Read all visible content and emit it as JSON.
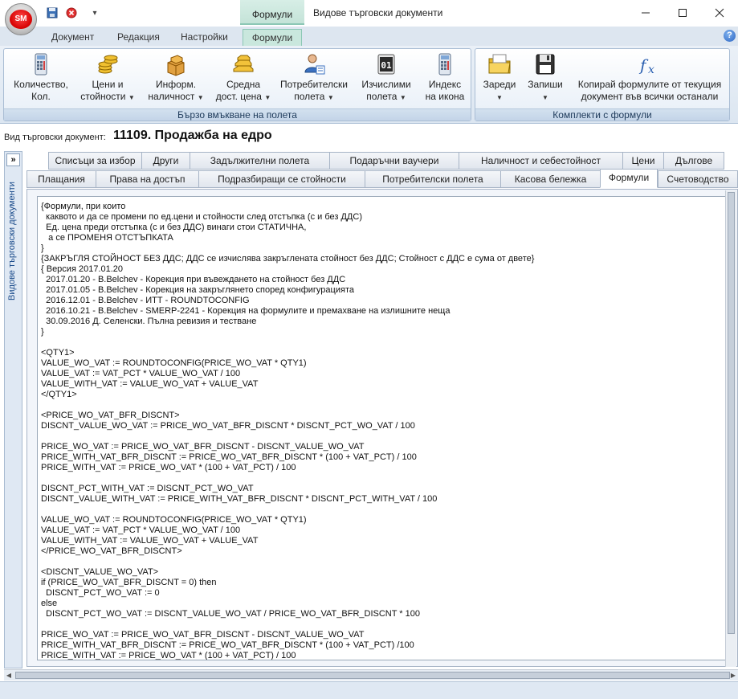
{
  "app": {
    "orb_label": "SM",
    "context_tab_title": "Формули",
    "window_title": "Видове търговски документи"
  },
  "ribbon_tabs": [
    "Документ",
    "Редакция",
    "Настройки",
    "Формули"
  ],
  "ribbon_groups": [
    {
      "label": "Бързо вмъкване на полета",
      "buttons": [
        {
          "line1": "Количество,",
          "line2": "Кол.",
          "has_dropdown": false,
          "icon": "calculator-icon"
        },
        {
          "line1": "Цени и",
          "line2": "стойности",
          "has_dropdown": true,
          "icon": "coins-icon"
        },
        {
          "line1": "Информ.",
          "line2": "наличност",
          "has_dropdown": true,
          "icon": "boxes-icon"
        },
        {
          "line1": "Средна",
          "line2": "дост. цена",
          "has_dropdown": true,
          "icon": "gold-bars-icon"
        },
        {
          "line1": "Потребителски",
          "line2": "полета",
          "has_dropdown": true,
          "icon": "user-fields-icon"
        },
        {
          "line1": "Изчислими",
          "line2": "полета",
          "has_dropdown": true,
          "icon": "counter-icon"
        },
        {
          "line1": "Индекс",
          "line2": "на икона",
          "has_dropdown": false,
          "icon": "calculator-icon"
        }
      ]
    },
    {
      "label": "Комплекти с формули",
      "buttons": [
        {
          "line1": "Зареди",
          "line2": "",
          "has_dropdown": true,
          "icon": "folder-icon"
        },
        {
          "line1": "Запиши",
          "line2": "",
          "has_dropdown": true,
          "icon": "floppy-disk-icon"
        },
        {
          "line1": "Копирай формулите от текущия",
          "line2": "документ във всички останали",
          "has_dropdown": false,
          "icon": "fx-icon"
        }
      ]
    }
  ],
  "document": {
    "type_label": "Вид търговски документ:",
    "title": "11109. Продажба на едро"
  },
  "side_panel": {
    "toggle_label": "»",
    "label": "Видове търговски документи"
  },
  "tabs_row1": [
    "Списъци за избор",
    "Други",
    "Задължителни полета",
    "Подаръчни ваучери",
    "Наличност и себестойност",
    "Цени",
    "Дългове"
  ],
  "tabs_row2": [
    "Плащания",
    "Права на достъп",
    "Подразбиращи се стойности",
    "Потребителски полета",
    "Касова бележка",
    "Формули",
    "Счетоводство"
  ],
  "active_tab": "Формули",
  "formula_lines": [
    "{Формули, при които",
    "  каквото и да се промени по ед.цени и стойности след отстъпка (с и без ДДС)",
    "  Ед. цена преди отстъпка (с и без ДДС) винаги стои СТАТИЧНА,",
    "   а се ПРОМЕНЯ ОТСТЪПКАТА",
    "}",
    "{ЗАКРЪГЛЯ СТОЙНОСТ БЕЗ ДДС; ДДС се изчислява закръглената стойност без ДДС; Стойност с ДДС е сума от двете}",
    "{ Версия 2017.01.20",
    "  2017.01.20 - B.Belchev - Корекция при въвеждането на стойност без ДДС",
    "  2017.01.05 - B.Belchev - Корекция на закръглянето според конфигурацията",
    "  2016.12.01 - B.Belchev - ИТТ - ROUNDTOCONFIG",
    "  2016.10.21 - B.Belchev - SMERP-2241 - Корекция на формулите и премахване на излишните неща",
    "  30.09.2016 Д. Селенски. Пълна ревизия и тестване",
    "}",
    "",
    "<QTY1>",
    "VALUE_WO_VAT := ROUNDTOCONFIG(PRICE_WO_VAT * QTY1)",
    "VALUE_VAT := VAT_PCT * VALUE_WO_VAT / 100",
    "VALUE_WITH_VAT := VALUE_WO_VAT + VALUE_VAT",
    "</QTY1>",
    "",
    "<PRICE_WO_VAT_BFR_DISCNT>",
    "DISCNT_VALUE_WO_VAT := PRICE_WO_VAT_BFR_DISCNT * DISCNT_PCT_WO_VAT / 100",
    "",
    "PRICE_WO_VAT := PRICE_WO_VAT_BFR_DISCNT - DISCNT_VALUE_WO_VAT",
    "PRICE_WITH_VAT_BFR_DISCNT := PRICE_WO_VAT_BFR_DISCNT * (100 + VAT_PCT) / 100",
    "PRICE_WITH_VAT := PRICE_WO_VAT * (100 + VAT_PCT) / 100",
    "",
    "DISCNT_PCT_WITH_VAT := DISCNT_PCT_WO_VAT",
    "DISCNT_VALUE_WITH_VAT := PRICE_WITH_VAT_BFR_DISCNT * DISCNT_PCT_WITH_VAT / 100",
    "",
    "VALUE_WO_VAT := ROUNDTOCONFIG(PRICE_WO_VAT * QTY1)",
    "VALUE_VAT := VAT_PCT * VALUE_WO_VAT / 100",
    "VALUE_WITH_VAT := VALUE_WO_VAT + VALUE_VAT",
    "</PRICE_WO_VAT_BFR_DISCNT>",
    "",
    "<DISCNT_VALUE_WO_VAT>",
    "if (PRICE_WO_VAT_BFR_DISCNT = 0) then",
    "  DISCNT_PCT_WO_VAT := 0",
    "else",
    "  DISCNT_PCT_WO_VAT := DISCNT_VALUE_WO_VAT / PRICE_WO_VAT_BFR_DISCNT * 100",
    "",
    "PRICE_WO_VAT := PRICE_WO_VAT_BFR_DISCNT - DISCNT_VALUE_WO_VAT",
    "PRICE_WITH_VAT_BFR_DISCNT := PRICE_WO_VAT_BFR_DISCNT * (100 + VAT_PCT) /100",
    "PRICE_WITH_VAT := PRICE_WO_VAT * (100 + VAT_PCT) / 100"
  ],
  "colors": {
    "accent": "#8cc7b5",
    "ribbon_bg": "#dce6f1",
    "side_label": "#1d4d8c"
  }
}
